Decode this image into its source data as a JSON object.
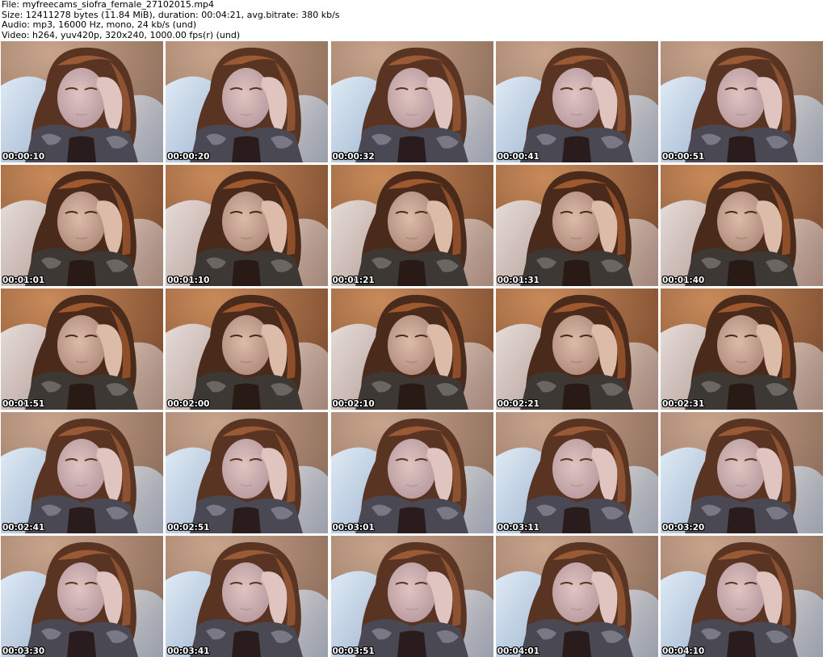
{
  "header": {
    "file": "File: myfreecams_siofra_female_27102015.mp4",
    "size": "Size: 12411278 bytes (11.84 MiB), duration: 00:04:21, avg.bitrate: 380 kb/s",
    "audio": "Audio: mp3, 16000 Hz, mono, 24 kb/s (und)",
    "video": "Video: h264, yuv420p, 320x240, 1000.00 fps(r) (und)"
  },
  "frames": [
    {
      "timestamp": "00:00:10",
      "tone": "cool"
    },
    {
      "timestamp": "00:00:20",
      "tone": "cool"
    },
    {
      "timestamp": "00:00:32",
      "tone": "cool"
    },
    {
      "timestamp": "00:00:41",
      "tone": "cool"
    },
    {
      "timestamp": "00:00:51",
      "tone": "cool"
    },
    {
      "timestamp": "00:01:01",
      "tone": "warm"
    },
    {
      "timestamp": "00:01:10",
      "tone": "warm"
    },
    {
      "timestamp": "00:01:21",
      "tone": "warm"
    },
    {
      "timestamp": "00:01:31",
      "tone": "warm"
    },
    {
      "timestamp": "00:01:40",
      "tone": "warm"
    },
    {
      "timestamp": "00:01:51",
      "tone": "warm"
    },
    {
      "timestamp": "00:02:00",
      "tone": "warm"
    },
    {
      "timestamp": "00:02:10",
      "tone": "warm"
    },
    {
      "timestamp": "00:02:21",
      "tone": "warm"
    },
    {
      "timestamp": "00:02:31",
      "tone": "warm"
    },
    {
      "timestamp": "00:02:41",
      "tone": "cool"
    },
    {
      "timestamp": "00:02:51",
      "tone": "cool"
    },
    {
      "timestamp": "00:03:01",
      "tone": "cool"
    },
    {
      "timestamp": "00:03:11",
      "tone": "cool"
    },
    {
      "timestamp": "00:03:20",
      "tone": "cool"
    },
    {
      "timestamp": "00:03:30",
      "tone": "cool"
    },
    {
      "timestamp": "00:03:41",
      "tone": "cool"
    },
    {
      "timestamp": "00:03:51",
      "tone": "cool"
    },
    {
      "timestamp": "00:04:01",
      "tone": "cool"
    },
    {
      "timestamp": "00:04:10",
      "tone": "cool"
    }
  ],
  "palette": {
    "cool": {
      "wall": "#c8a48c",
      "wall_dark": "#8a6a58",
      "pillow": "#dfeaf5",
      "pillow_shade": "#9fb5cf",
      "hair": "#5a3422",
      "hair_light": "#9a5a36",
      "skin": "#e0c4c0",
      "skin_shade": "#b89aa0",
      "scarf": "#4a4852",
      "scarf_light": "#9a9aa6",
      "shirt": "#2a1c1c"
    },
    "warm": {
      "wall": "#c88a5a",
      "wall_dark": "#7a4a2e",
      "pillow": "#e6dcd8",
      "pillow_shade": "#b59e98",
      "hair": "#4a2a1a",
      "hair_light": "#a0582e",
      "skin": "#dcbca8",
      "skin_shade": "#b08a7c",
      "scarf": "#3e3834",
      "scarf_light": "#8a8680",
      "shirt": "#2a1a16"
    }
  }
}
